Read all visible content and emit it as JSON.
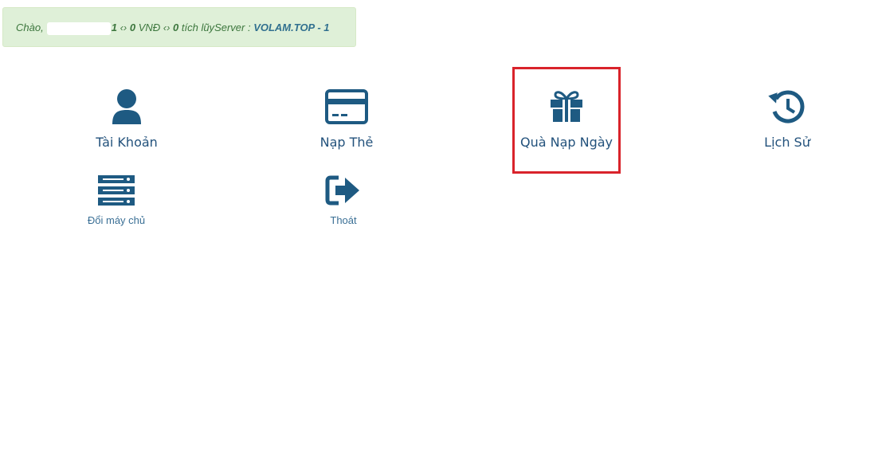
{
  "greeting": {
    "prefix": "Chào,",
    "suffix_digit": "1",
    "sep1": "‹› ",
    "balance_value": "0",
    "balance_unit": " VNĐ ",
    "sep2": "‹› ",
    "points_value": "0",
    "points_label": " tích lũy",
    "server_label": "Server : ",
    "server_name": "VOLAM.TOP - 1"
  },
  "menu": {
    "account": {
      "label": "Tài Khoản",
      "icon": "user-icon"
    },
    "topup": {
      "label": "Nạp Thẻ",
      "icon": "credit-card-icon"
    },
    "daily_gift": {
      "label": "Quà Nạp Ngày",
      "icon": "gift-icon"
    },
    "history": {
      "label": "Lịch Sử",
      "icon": "history-icon"
    },
    "change_server": {
      "label": "Đổi máy chủ",
      "icon": "server-icon"
    },
    "logout": {
      "label": "Thoát",
      "icon": "sign-out-icon"
    }
  },
  "colors": {
    "icon": "#1e4f74",
    "highlight": "#d9232b",
    "alert_bg": "#dff0d8"
  }
}
